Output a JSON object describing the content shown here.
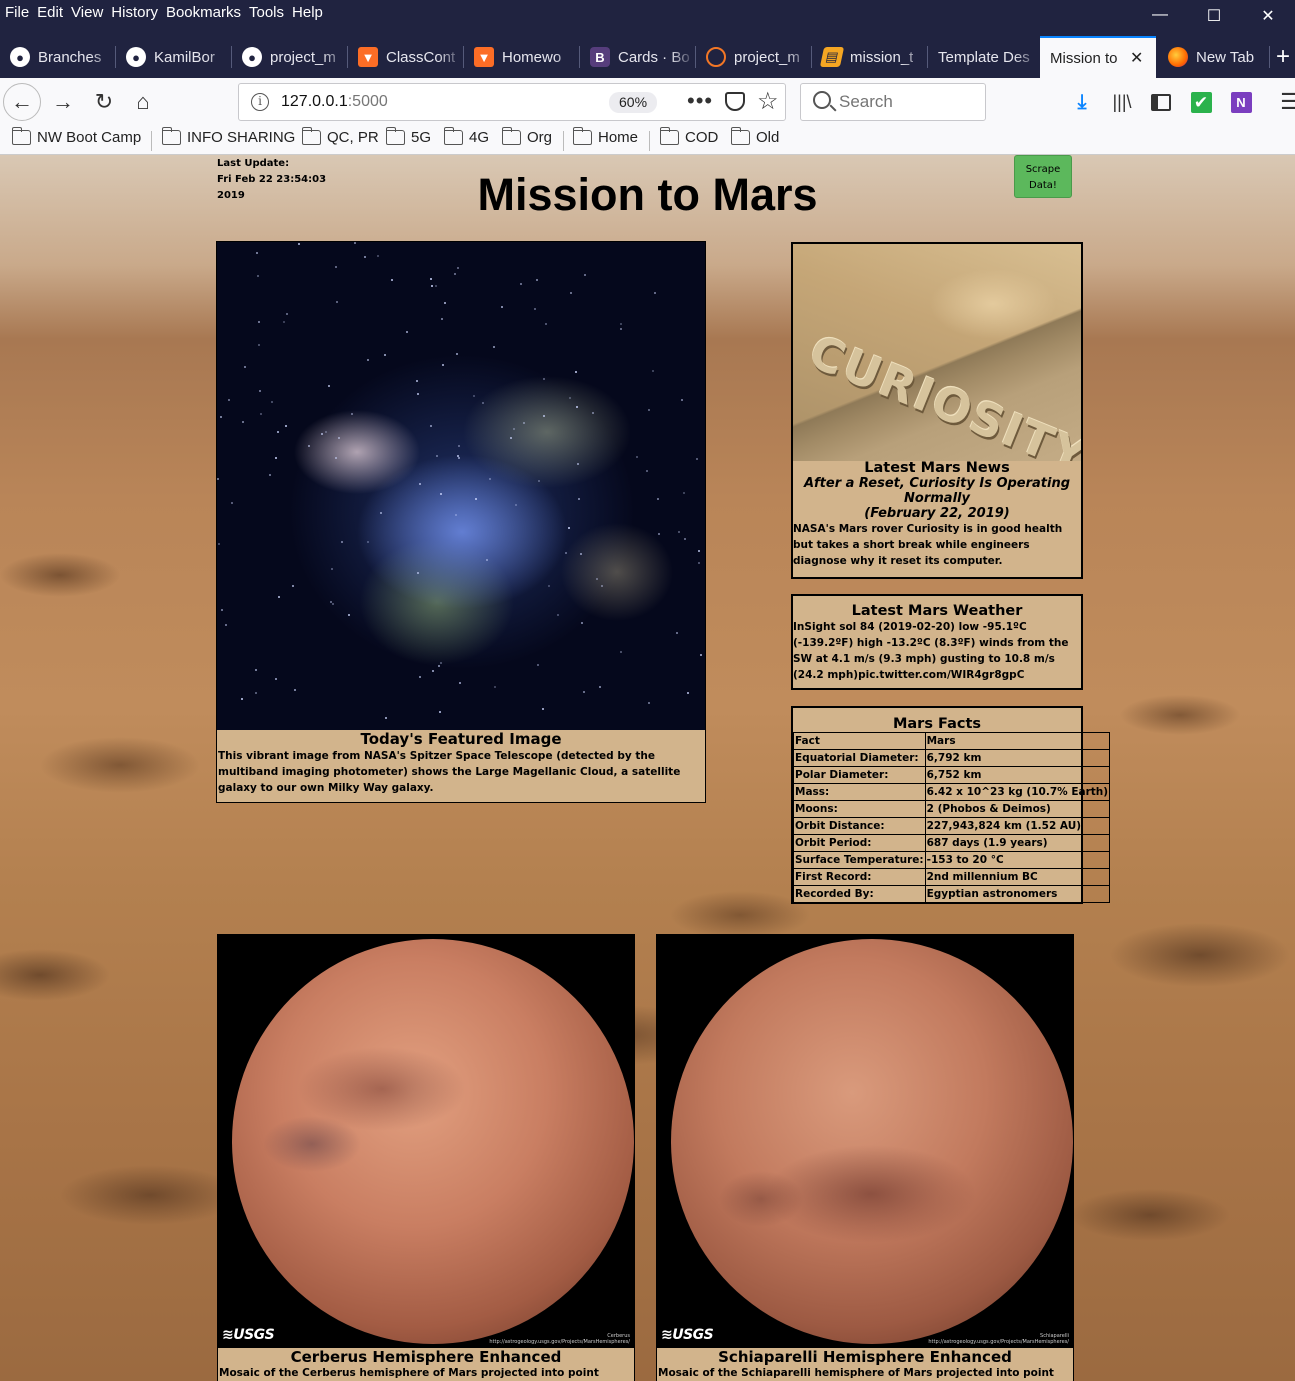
{
  "menubar": {
    "items": [
      "File",
      "Edit",
      "View",
      "History",
      "Bookmarks",
      "Tools",
      "Help"
    ],
    "window_controls": {
      "minimize": "—",
      "maximize": "☐",
      "close": "✕"
    }
  },
  "tabs": [
    {
      "label": "Branches",
      "icon": "github-icon"
    },
    {
      "label": "KamilBor",
      "icon": "github-icon"
    },
    {
      "label": "project_m",
      "icon": "github-icon"
    },
    {
      "label": "ClassCont",
      "icon": "gitlab-icon"
    },
    {
      "label": "Homewo",
      "icon": "gitlab-icon"
    },
    {
      "label": "Cards · Bo",
      "icon": "bootstrap-icon"
    },
    {
      "label": "project_m",
      "icon": "jupyter-icon"
    },
    {
      "label": "mission_t",
      "icon": "notebook-icon"
    },
    {
      "label": "Template Des",
      "icon": ""
    },
    {
      "label": "Mission to",
      "icon": "",
      "active": true
    },
    {
      "label": "New Tab",
      "icon": "firefox-icon"
    }
  ],
  "navbar": {
    "url_host": "127.0.0.1",
    "url_port": ":5000",
    "zoom": "60%",
    "search_placeholder": "Search"
  },
  "bookmarks": [
    {
      "label": "NW Boot Camp"
    },
    {
      "label": "INFO SHARING"
    },
    {
      "label": "QC, PR"
    },
    {
      "label": "5G"
    },
    {
      "label": "4G"
    },
    {
      "label": "Org"
    },
    {
      "label": "Home"
    },
    {
      "label": "COD"
    },
    {
      "label": "Old"
    }
  ],
  "page": {
    "last_update_label": "Last Update:",
    "last_update_line1": "Fri Feb 22 23:54:03",
    "last_update_line2": "2019",
    "title": "Mission to Mars",
    "scrape_line1": "Scrape",
    "scrape_line2": "Data!",
    "scrape_color": "#5cb85c",
    "card_color": "#d2b48c"
  },
  "featured": {
    "heading": "Today's Featured Image",
    "description": "This vibrant image from NASA's Spitzer Space Telescope (detected by the multiband imaging photometer) shows the Large Magellanic Cloud, a satellite galaxy to our own Milky Way galaxy."
  },
  "news": {
    "image_caption": "CURIOSITY",
    "heading": "Latest Mars News",
    "title": "After a Reset, Curiosity Is Operating Normally",
    "date": "(February 22, 2019)",
    "teaser": "NASA's Mars rover Curiosity is in good health but takes a short break while engineers diagnose why it reset its computer."
  },
  "weather": {
    "heading": "Latest Mars Weather",
    "text": "InSight sol 84 (2019-02-20) low -95.1ºC (-139.2ºF) high -13.2ºC (8.3ºF) winds from the SW at 4.1 m/s (9.3 mph) gusting to 10.8 m/s (24.2 mph)pic.twitter.com/WIR4gr8gpC"
  },
  "facts": {
    "heading": "Mars Facts",
    "rows": [
      [
        "Fact",
        "Mars"
      ],
      [
        "Equatorial Diameter:",
        "6,792 km"
      ],
      [
        "Polar Diameter:",
        "6,752 km"
      ],
      [
        "Mass:",
        "6.42 x 10^23 kg (10.7% Earth)"
      ],
      [
        "Moons:",
        "2 (Phobos & Deimos)"
      ],
      [
        "Orbit Distance:",
        "227,943,824 km (1.52 AU)"
      ],
      [
        "Orbit Period:",
        "687 days (1.9 years)"
      ],
      [
        "Surface Temperature:",
        "-153 to 20 °C"
      ],
      [
        "First Record:",
        "2nd millennium BC"
      ],
      [
        "Recorded By:",
        "Egyptian astronomers"
      ]
    ]
  },
  "hemispheres": [
    {
      "title": "Cerberus Hemisphere Enhanced",
      "description": "Mosaic of the Cerberus hemisphere of Mars projected into point",
      "logo": "≋USGS",
      "credit_name": "Cerberus",
      "credit_url": "http://astrogeology.usgs.gov/Projects/MarsHemispheres/"
    },
    {
      "title": "Schiaparelli Hemisphere Enhanced",
      "description": "Mosaic of the Schiaparelli hemisphere of Mars projected into point",
      "logo": "≋USGS",
      "credit_name": "Schiaparelli",
      "credit_url": "http://astrogeology.usgs.gov/Projects/MarsHemispheres/"
    }
  ]
}
